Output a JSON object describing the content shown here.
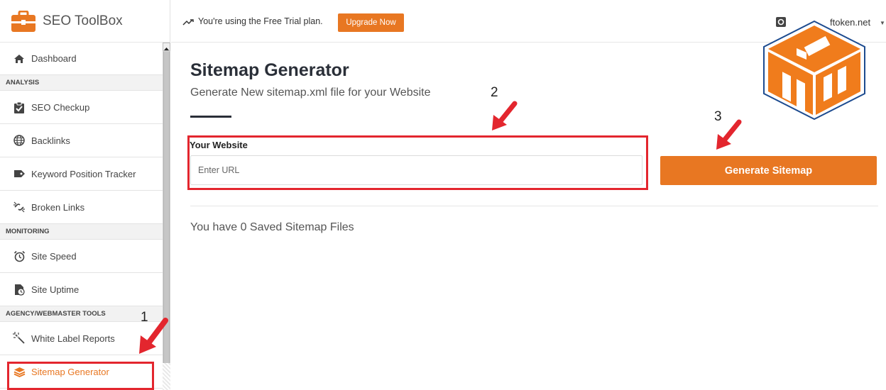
{
  "app": {
    "name": "SEO ToolBox"
  },
  "topbar": {
    "trial_text": "You're using the Free Trial plan.",
    "upgrade_label": "Upgrade Now",
    "account_domain": "ftoken.net"
  },
  "sidebar": {
    "items": [
      {
        "type": "item",
        "label": "Dashboard",
        "icon": "home-icon"
      },
      {
        "type": "section",
        "label": "ANALYSIS"
      },
      {
        "type": "item",
        "label": "SEO Checkup",
        "icon": "clipboard-check-icon"
      },
      {
        "type": "item",
        "label": "Backlinks",
        "icon": "globe-icon"
      },
      {
        "type": "item",
        "label": "Keyword Position Tracker",
        "icon": "tag-icon"
      },
      {
        "type": "item",
        "label": "Broken Links",
        "icon": "broken-link-icon"
      },
      {
        "type": "section",
        "label": "MONITORING"
      },
      {
        "type": "item",
        "label": "Site Speed",
        "icon": "alarm-clock-icon"
      },
      {
        "type": "item",
        "label": "Site Uptime",
        "icon": "uptime-icon"
      },
      {
        "type": "section",
        "label": "AGENCY/WEBMASTER TOOLS"
      },
      {
        "type": "item",
        "label": "White Label Reports",
        "icon": "magic-wand-icon"
      },
      {
        "type": "item",
        "label": "Sitemap Generator",
        "icon": "layers-icon",
        "active": true
      }
    ]
  },
  "main": {
    "title": "Sitemap Generator",
    "subtitle": "Generate New sitemap.xml file for your Website",
    "field_label": "Your Website",
    "url_placeholder": "Enter URL",
    "generate_label": "Generate Sitemap",
    "saved_text": "You have 0 Saved Sitemap Files"
  },
  "annotations": {
    "step1": "1",
    "step2": "2",
    "step3": "3"
  },
  "colors": {
    "accent": "#e87722",
    "annotation": "#e3262e",
    "title": "#2a2f38"
  }
}
